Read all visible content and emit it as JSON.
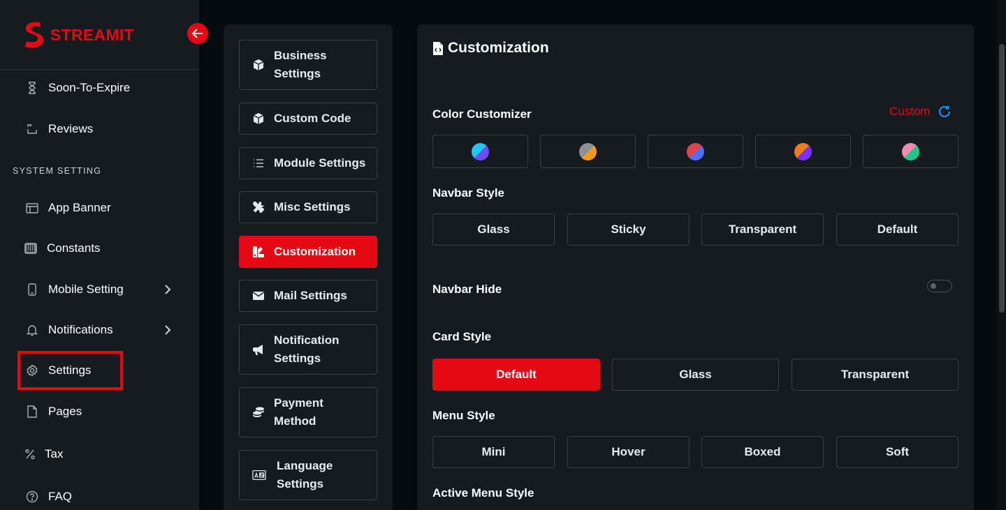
{
  "brand": {
    "name": "STREAMIT",
    "color": "#e50914"
  },
  "sidebar": {
    "items_top": [
      {
        "label": "Soon-To-Expire",
        "icon": "hourglass-icon"
      },
      {
        "label": "Reviews",
        "icon": "review-icon"
      }
    ],
    "section_title": "SYSTEM SETTING",
    "items": [
      {
        "label": "App Banner",
        "icon": "banner-icon"
      },
      {
        "label": "Constants",
        "icon": "keyboard-icon"
      },
      {
        "label": "Mobile Setting",
        "icon": "mobile-icon",
        "has_submenu": true
      },
      {
        "label": "Notifications",
        "icon": "bell-icon",
        "has_submenu": true
      },
      {
        "label": "Settings",
        "icon": "gear-icon",
        "highlighted": true
      },
      {
        "label": "Pages",
        "icon": "page-icon"
      },
      {
        "label": "Tax",
        "icon": "percent-icon"
      },
      {
        "label": "FAQ",
        "icon": "question-icon"
      }
    ]
  },
  "settings_menu": [
    {
      "label": "Business Settings",
      "line1": "Business",
      "line2": "Settings",
      "icon": "cube-icon"
    },
    {
      "label": "Custom Code",
      "icon": "cube-icon"
    },
    {
      "label": "Module Settings",
      "icon": "list-icon"
    },
    {
      "label": "Misc Settings",
      "icon": "tools-icon"
    },
    {
      "label": "Customization",
      "icon": "palette-icon",
      "active": true
    },
    {
      "label": "Mail Settings",
      "icon": "envelope-icon"
    },
    {
      "label": "Notification Settings",
      "line1": "Notification",
      "line2": "Settings",
      "icon": "megaphone-icon"
    },
    {
      "label": "Payment Method",
      "line1": "Payment",
      "line2": "Method",
      "icon": "coins-icon"
    },
    {
      "label": "Language Settings",
      "line1": "Language",
      "line2": "Settings",
      "icon": "language-icon"
    }
  ],
  "customization": {
    "title": "Customization",
    "color_customizer": {
      "label": "Color Customizer",
      "custom_label": "Custom",
      "swatches": [
        {
          "a": "#1ec8f0",
          "b": "#6b4cf5"
        },
        {
          "a": "#8a9096",
          "b": "#f29a1a"
        },
        {
          "a": "#e2434b",
          "b": "#4c6ff5"
        },
        {
          "a": "#f27a1a",
          "b": "#7a33f5"
        },
        {
          "a": "#f08ab0",
          "b": "#1ec88a"
        }
      ]
    },
    "navbar_style": {
      "label": "Navbar Style",
      "options": [
        "Glass",
        "Sticky",
        "Transparent",
        "Default"
      ]
    },
    "navbar_hide": {
      "label": "Navbar Hide",
      "enabled": false
    },
    "card_style": {
      "label": "Card Style",
      "options": [
        "Default",
        "Glass",
        "Transparent"
      ],
      "active": "Default"
    },
    "menu_style": {
      "label": "Menu Style",
      "options": [
        "Mini",
        "Hover",
        "Boxed",
        "Soft"
      ]
    },
    "active_menu_style": {
      "label": "Active Menu Style"
    }
  },
  "colors": {
    "accent": "#e50914",
    "panel": "#151b20",
    "background": "#050b10",
    "reset_icon": "#1e8ef0"
  }
}
